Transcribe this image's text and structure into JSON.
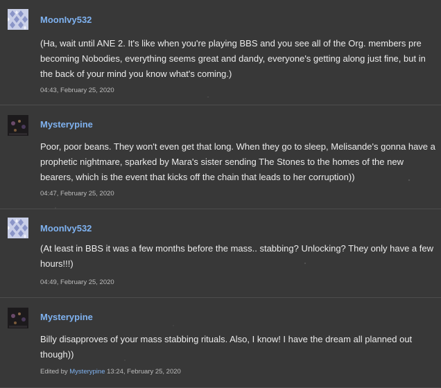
{
  "comments": [
    {
      "avatar_icon": "diamond-pattern-avatar-icon",
      "author": "MoonIvy532",
      "text": "(Ha, wait until ANE 2. It's like when you're playing BBS and you see all of the Org. members pre becoming Nobodies, everything seems great and dandy, everyone's getting along just fine, but in the back of your mind you know what's coming.)",
      "timestamp": "04:43, February 25, 2020"
    },
    {
      "avatar_icon": "dark-photo-avatar-icon",
      "author": "Mysterypine",
      "text": "Poor, poor beans. They won't even get that long. When they go to sleep, Melisande's gonna have a prophetic nightmare, sparked by Mara's sister sending The Stones to the homes of the new bearers, which is the event that kicks off the chain that leads to her corruption))",
      "timestamp": "04:47, February 25, 2020"
    },
    {
      "avatar_icon": "diamond-pattern-avatar-icon",
      "author": "MoonIvy532",
      "text": "(At least in BBS it was a few months before the mass.. stabbing? Unlocking? They only have a few hours!!!)",
      "timestamp": "04:49, February 25, 2020"
    },
    {
      "avatar_icon": "dark-photo-avatar-icon",
      "author": "Mysterypine",
      "text": "Billy disapproves of your mass stabbing rituals. Also, I know! I have the dream all planned out though))",
      "edited_prefix": "Edited by",
      "edited_by": "Mysterypine",
      "timestamp": "13:24, February 25, 2020"
    }
  ],
  "colors": {
    "background": "#383838",
    "author_link": "#7fb2f0",
    "body_text": "#ececec",
    "meta_text": "#bdbdbd",
    "divider": "#4d4d4d"
  }
}
